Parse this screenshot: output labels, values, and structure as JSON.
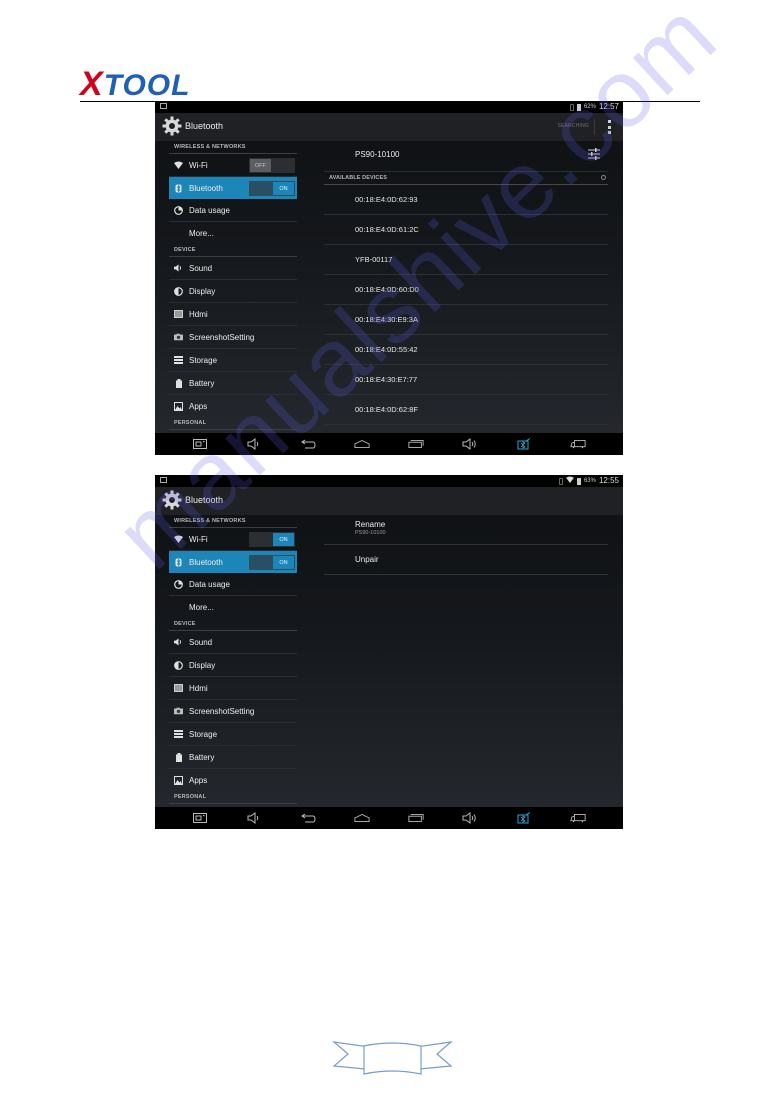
{
  "header": {
    "logo_first": "X",
    "logo_rest": "TOOL"
  },
  "watermark": "manualshive.com",
  "colors": {
    "accent": "#1c86b8",
    "logo_red": "#d4001a",
    "logo_blue": "#1f5fb5"
  },
  "screens": [
    {
      "status": {
        "battery": "62%",
        "time": "12:57",
        "wifi": false
      },
      "actionbar": {
        "title": "Bluetooth",
        "searching": "SEARCHING",
        "menu_icon": "overflow-menu-icon"
      },
      "sidebar": {
        "sections": {
          "wireless": "WIRELESS & NETWORKS",
          "device": "DEVICE",
          "personal": "PERSONAL"
        },
        "items": [
          {
            "label": "Wi-Fi",
            "icon": "wifi-icon",
            "toggle": "OFF"
          },
          {
            "label": "Bluetooth",
            "icon": "bluetooth-icon",
            "toggle": "ON",
            "active": true
          },
          {
            "label": "Data usage",
            "icon": "data-usage-icon"
          },
          {
            "label": "More..."
          },
          {
            "label": "Sound",
            "icon": "sound-icon"
          },
          {
            "label": "Display",
            "icon": "display-icon"
          },
          {
            "label": "Hdmi",
            "icon": "hdmi-icon"
          },
          {
            "label": "ScreenshotSetting",
            "icon": "camera-icon"
          },
          {
            "label": "Storage",
            "icon": "storage-icon"
          },
          {
            "label": "Battery",
            "icon": "battery-icon"
          },
          {
            "label": "Apps",
            "icon": "apps-icon"
          }
        ]
      },
      "pane": {
        "device_name": "PS90-10100",
        "available_header": "AVAILABLE DEVICES",
        "devices": [
          "00:18:E4:0D:62:93",
          "00:18:E4:0D:61:2C",
          "YFB-00117",
          "00:18:E4:0D:60:D0",
          "00:18:E4:30:E9:3A",
          "00:18:E4:0D:55:42",
          "00:18:E4:30:E7:77",
          "00:18:E4:0D:62:8F"
        ]
      }
    },
    {
      "status": {
        "battery": "63%",
        "time": "12:55",
        "wifi": true
      },
      "actionbar": {
        "title": "Bluetooth"
      },
      "sidebar": {
        "sections": {
          "wireless": "WIRELESS & NETWORKS",
          "device": "DEVICE",
          "personal": "PERSONAL"
        },
        "items": [
          {
            "label": "Wi-Fi",
            "icon": "wifi-icon",
            "toggle": "ON"
          },
          {
            "label": "Bluetooth",
            "icon": "bluetooth-icon",
            "toggle": "ON",
            "active": true
          },
          {
            "label": "Data usage",
            "icon": "data-usage-icon"
          },
          {
            "label": "More..."
          },
          {
            "label": "Sound",
            "icon": "sound-icon"
          },
          {
            "label": "Display",
            "icon": "display-icon"
          },
          {
            "label": "Hdmi",
            "icon": "hdmi-icon"
          },
          {
            "label": "ScreenshotSetting",
            "icon": "camera-icon"
          },
          {
            "label": "Storage",
            "icon": "storage-icon"
          },
          {
            "label": "Battery",
            "icon": "battery-icon"
          },
          {
            "label": "Apps",
            "icon": "apps-icon"
          }
        ]
      },
      "pane": {
        "rename_label": "Rename",
        "rename_value": "PS90-10100",
        "unpair_label": "Unpair"
      }
    }
  ],
  "navbar_icons": [
    "screenshot-icon",
    "volume-down-icon",
    "back-icon",
    "home-icon",
    "recents-icon",
    "volume-up-icon",
    "bluetooth-vci-icon",
    "truck-icon"
  ]
}
